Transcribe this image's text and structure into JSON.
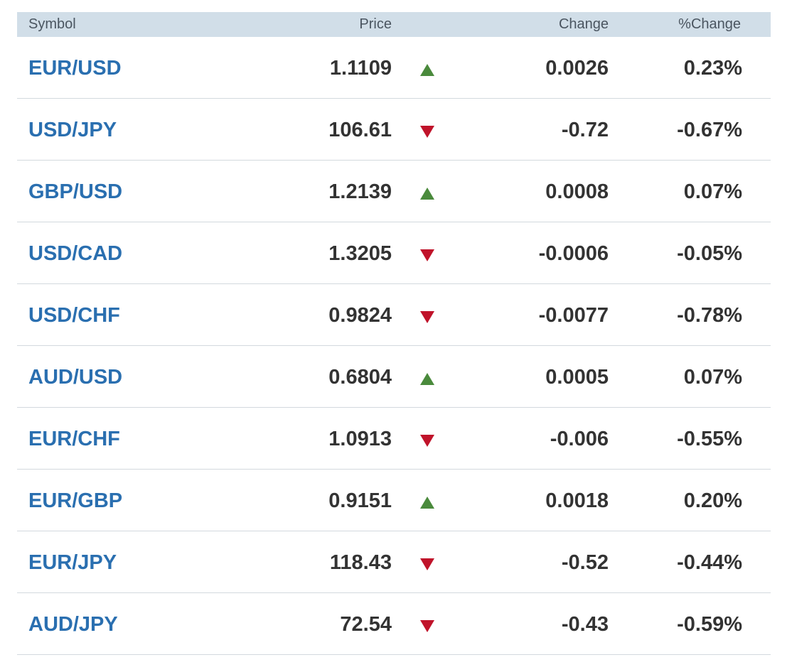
{
  "header": {
    "symbol": "Symbol",
    "price": "Price",
    "change": "Change",
    "pct_change": "%Change"
  },
  "colors": {
    "up": "#4a8a3c",
    "down": "#c0132a",
    "link": "#2a6fb0",
    "header_bg": "#d1dee8"
  },
  "rows": [
    {
      "symbol": "EUR/USD",
      "price": "1.1109",
      "direction": "up",
      "direction_icon": "triangle-up-icon",
      "change": "0.0026",
      "pct_change": "0.23%"
    },
    {
      "symbol": "USD/JPY",
      "price": "106.61",
      "direction": "down",
      "direction_icon": "triangle-down-icon",
      "change": "-0.72",
      "pct_change": "-0.67%"
    },
    {
      "symbol": "GBP/USD",
      "price": "1.2139",
      "direction": "up",
      "direction_icon": "triangle-up-icon",
      "change": "0.0008",
      "pct_change": "0.07%"
    },
    {
      "symbol": "USD/CAD",
      "price": "1.3205",
      "direction": "down",
      "direction_icon": "triangle-down-icon",
      "change": "-0.0006",
      "pct_change": "-0.05%"
    },
    {
      "symbol": "USD/CHF",
      "price": "0.9824",
      "direction": "down",
      "direction_icon": "triangle-down-icon",
      "change": "-0.0077",
      "pct_change": "-0.78%"
    },
    {
      "symbol": "AUD/USD",
      "price": "0.6804",
      "direction": "up",
      "direction_icon": "triangle-up-icon",
      "change": "0.0005",
      "pct_change": "0.07%"
    },
    {
      "symbol": "EUR/CHF",
      "price": "1.0913",
      "direction": "down",
      "direction_icon": "triangle-down-icon",
      "change": "-0.006",
      "pct_change": "-0.55%"
    },
    {
      "symbol": "EUR/GBP",
      "price": "0.9151",
      "direction": "up",
      "direction_icon": "triangle-up-icon",
      "change": "0.0018",
      "pct_change": "0.20%"
    },
    {
      "symbol": "EUR/JPY",
      "price": "118.43",
      "direction": "down",
      "direction_icon": "triangle-down-icon",
      "change": "-0.52",
      "pct_change": "-0.44%"
    },
    {
      "symbol": "AUD/JPY",
      "price": "72.54",
      "direction": "down",
      "direction_icon": "triangle-down-icon",
      "change": "-0.43",
      "pct_change": "-0.59%"
    }
  ]
}
